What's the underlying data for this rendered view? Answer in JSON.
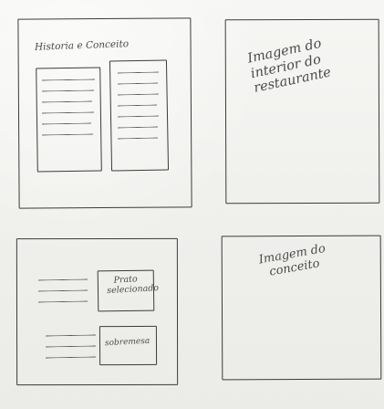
{
  "panels": {
    "top_left": {
      "title": "Historia e Conceito"
    },
    "top_right": {
      "image_label": "Imagem do\ninterior do\nrestaurante"
    },
    "bottom_left": {
      "highlight_label": "Prato\nselecionado",
      "dessert_label": "sobremesa"
    },
    "bottom_right": {
      "image_label": "Imagem do\nconceito"
    }
  }
}
